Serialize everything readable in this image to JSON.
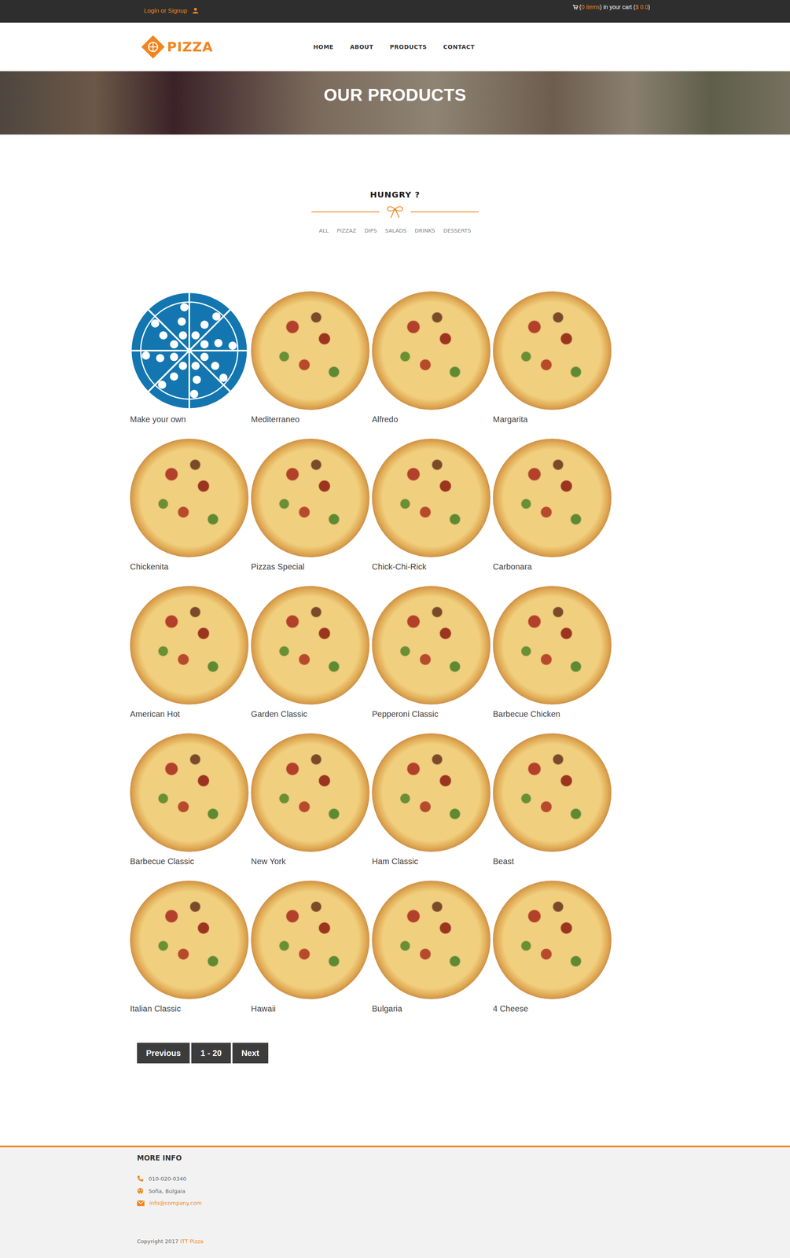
{
  "topbar": {
    "login": "Login or Signup",
    "cart": {
      "prefix": "(",
      "count": "0 items",
      "middle": ") in your cart (",
      "total": "$ 0.0",
      "suffix": ")"
    }
  },
  "logo": {
    "text": "PIZZA"
  },
  "nav": [
    "HOME",
    "ABOUT",
    "PRODUCTS",
    "CONTACT"
  ],
  "banner": {
    "title": "OUR PRODUCTS"
  },
  "section": {
    "title": "HUNGRY ?",
    "filters": [
      "ALL",
      "PIZZAZ",
      "DIPS",
      "SALADS",
      "DRINKS",
      "DESSERTS"
    ]
  },
  "products": [
    {
      "name": "Make your own",
      "kind": "icon"
    },
    {
      "name": "Mediterraneo",
      "kind": "photo"
    },
    {
      "name": "Alfredo",
      "kind": "photo"
    },
    {
      "name": "Margarita",
      "kind": "photo"
    },
    {
      "name": "Chickenita",
      "kind": "photo"
    },
    {
      "name": "Pizzas Special",
      "kind": "photo"
    },
    {
      "name": "Chick-Chi-Rick",
      "kind": "photo"
    },
    {
      "name": "Carbonara",
      "kind": "photo"
    },
    {
      "name": "American Hot",
      "kind": "photo"
    },
    {
      "name": "Garden Classic",
      "kind": "photo"
    },
    {
      "name": "Pepperoni Classic",
      "kind": "photo"
    },
    {
      "name": "Barbecue Chicken",
      "kind": "photo"
    },
    {
      "name": "Barbecue Classic",
      "kind": "photo"
    },
    {
      "name": "New York",
      "kind": "photo"
    },
    {
      "name": "Ham Classic",
      "kind": "photo"
    },
    {
      "name": "Beast",
      "kind": "photo"
    },
    {
      "name": "Italian Classic",
      "kind": "photo"
    },
    {
      "name": "Hawaii",
      "kind": "photo"
    },
    {
      "name": "Bulgaria",
      "kind": "photo"
    },
    {
      "name": "4 Cheese",
      "kind": "photo"
    }
  ],
  "pagination": [
    "Previous",
    "1 - 20",
    "Next"
  ],
  "footer": {
    "title": "MORE INFO",
    "phone": "010-020-0340",
    "location": "Sofia, Bulgaia",
    "email": "info@company.com",
    "copyright": "Copyright 2017 ",
    "brand": "ITT Pizza"
  }
}
